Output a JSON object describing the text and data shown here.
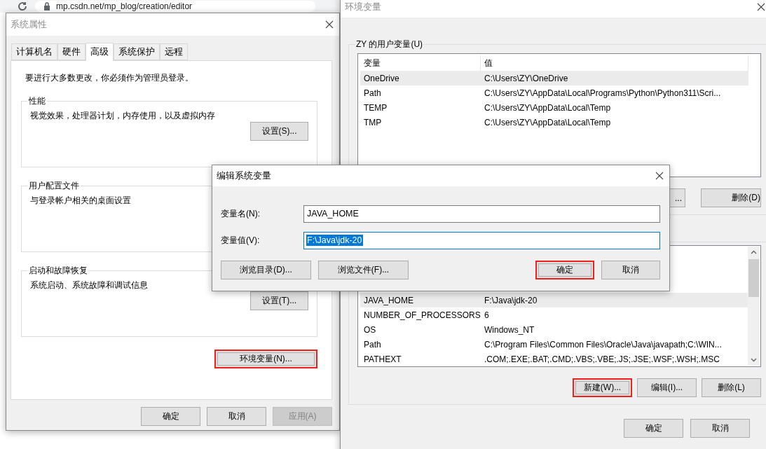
{
  "browser": {
    "url": "mp.csdn.net/mp_blog/creation/editor"
  },
  "system_properties": {
    "title": "系统属性",
    "tabs": [
      {
        "label": "计算机名",
        "selected": false
      },
      {
        "label": "硬件",
        "selected": false
      },
      {
        "label": "高级",
        "selected": true
      },
      {
        "label": "系统保护",
        "selected": false
      },
      {
        "label": "远程",
        "selected": false
      }
    ],
    "notice": "要进行大多数更改，你必须作为管理员登录。",
    "groups": [
      {
        "title": "性能",
        "description": "视觉效果，处理器计划，内存使用，以及虚拟内存",
        "button": "设置(S)..."
      },
      {
        "title": "用户配置文件",
        "description": "与登录帐户相关的桌面设置"
      },
      {
        "title": "启动和故障恢复",
        "description": "系统启动、系统故障和调试信息",
        "button": "设置(T)..."
      }
    ],
    "env_button": {
      "label": "环境变量(N)...",
      "highlighted": true
    },
    "buttons": [
      {
        "label": "确定",
        "disabled": false
      },
      {
        "label": "取消",
        "disabled": false
      },
      {
        "label": "应用(A)",
        "disabled": true
      }
    ]
  },
  "environment_variables": {
    "title": "环境变量",
    "user_group": "ZY 的用户变量(U)",
    "columns": [
      "变量",
      "值"
    ],
    "user_rows": [
      {
        "name": "OneDrive",
        "value": "C:\\Users\\ZY\\OneDrive",
        "selected": true
      },
      {
        "name": "Path",
        "value": "C:\\Users\\ZY\\AppData\\Local\\Programs\\Python\\Python311\\Scri...",
        "selected": false
      },
      {
        "name": "TEMP",
        "value": "C:\\Users\\ZY\\AppData\\Local\\Temp",
        "selected": false
      },
      {
        "name": "TMP",
        "value": "C:\\Users\\ZY\\AppData\\Local\\Temp",
        "selected": false
      }
    ],
    "user_buttons": [
      {
        "label": "...",
        "highlighted": false
      },
      {
        "label": "删除(D)",
        "highlighted": false
      }
    ],
    "system_rows": [
      {
        "name": "JAVA_HOME",
        "value": "F:\\Java\\jdk-20",
        "selected": true
      },
      {
        "name": "NUMBER_OF_PROCESSORS",
        "value": "6",
        "selected": false
      },
      {
        "name": "OS",
        "value": "Windows_NT",
        "selected": false
      },
      {
        "name": "Path",
        "value": "C:\\Program Files\\Common Files\\Oracle\\Java\\javapath;C:\\WIN...",
        "selected": false
      },
      {
        "name": "PATHEXT",
        "value": ".COM;.EXE;.BAT;.CMD;.VBS;.VBE;.JS;.JSE;.WSF;.WSH;.MSC",
        "selected": false
      }
    ],
    "system_buttons": [
      {
        "label": "新建(W)...",
        "highlighted": true
      },
      {
        "label": "编辑(I)...",
        "highlighted": false
      },
      {
        "label": "删除(L)",
        "highlighted": false
      }
    ],
    "buttons": [
      {
        "label": "确定",
        "disabled": false
      },
      {
        "label": "取消",
        "disabled": false
      }
    ]
  },
  "edit_dialog": {
    "title": "编辑系统变量",
    "fields": [
      {
        "label": "变量名(N):",
        "value": "JAVA_HOME",
        "selected": false
      },
      {
        "label": "变量值(V):",
        "value": "F:\\Java\\jdk-20",
        "selected": true
      }
    ],
    "left_buttons": [
      {
        "label": "浏览目录(D)...",
        "highlighted": false
      },
      {
        "label": "浏览文件(F)...",
        "highlighted": false
      }
    ],
    "right_buttons": [
      {
        "label": "确定",
        "highlighted": true
      },
      {
        "label": "取消",
        "highlighted": false
      }
    ]
  }
}
